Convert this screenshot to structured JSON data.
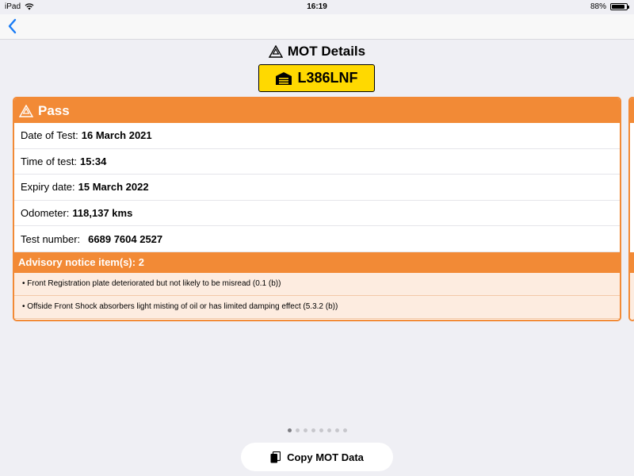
{
  "status_bar": {
    "device": "iPad",
    "time": "16:19",
    "battery": "88%",
    "battery_level": 0.88
  },
  "nav": {
    "back_icon": "chevron-left-icon"
  },
  "header": {
    "title": "MOT Details",
    "title_icon": "mot-triangle-icon"
  },
  "plate": {
    "registration": "L386LNF",
    "icon": "garage-icon"
  },
  "card": {
    "result": "Pass",
    "result_icon": "mot-triangle-icon",
    "rows": [
      {
        "label": "Date of Test:",
        "value": "16 March 2021"
      },
      {
        "label": "Time of test:",
        "value": "15:34"
      },
      {
        "label": "Expiry date:",
        "value": "15 March 2022"
      },
      {
        "label": "Odometer:",
        "value": "118,137 kms"
      },
      {
        "label": "Test number:",
        "value": "6689 7604 2527"
      }
    ],
    "advisory_title": "Advisory notice item(s): 2",
    "advisories": [
      "• Front Registration plate deteriorated but not likely to be misread (0.1 (b))",
      "• Offside Front Shock absorbers light misting of oil or has limited damping effect (5.3.2 (b))"
    ]
  },
  "pager": {
    "count": 8,
    "active_index": 0
  },
  "copy_button": {
    "label": "Copy MOT Data",
    "icon": "copy-icon"
  },
  "colors": {
    "accent": "#f28a36",
    "plate_yellow": "#ffd900",
    "advisory_bg": "#fdece0",
    "ios_blue": "#1a7cf5"
  }
}
